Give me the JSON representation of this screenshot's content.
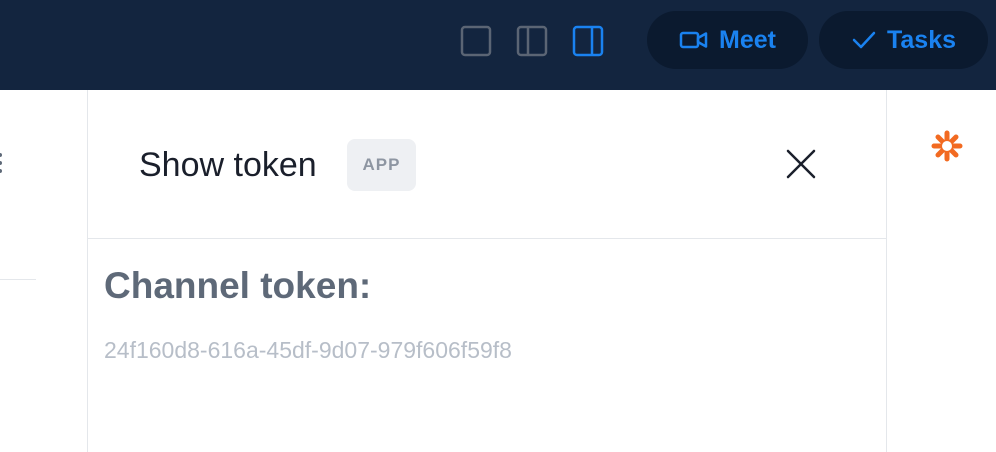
{
  "topbar": {
    "layout_buttons": [
      {
        "icon": "single-pane-icon",
        "active": false
      },
      {
        "icon": "split-left-pane-icon",
        "active": false
      },
      {
        "icon": "split-right-pane-icon",
        "active": true
      }
    ],
    "meet_label": "Meet",
    "meet_icon": "video-camera-icon",
    "tasks_label": "Tasks",
    "tasks_icon": "checkmark-icon",
    "accent_color": "#1a82f0",
    "background_color": "#13253f"
  },
  "panel": {
    "title": "Show token",
    "badge": "APP",
    "close_icon": "close-icon",
    "section_heading": "Channel token:",
    "token_value": "24f160d8-616a-45df-9d07-979f606f59f8"
  },
  "right_rail": {
    "icon": "asterisk-icon",
    "icon_color": "#f26a21"
  }
}
